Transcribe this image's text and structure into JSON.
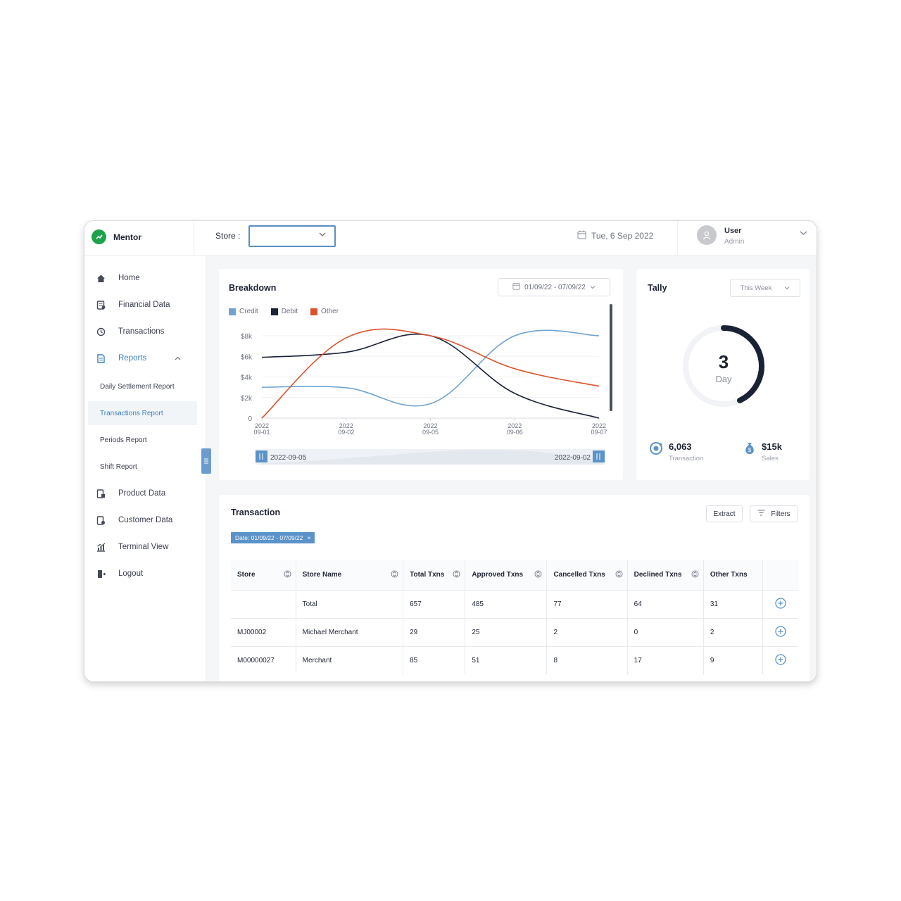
{
  "app": {
    "name": "Mentor"
  },
  "topbar": {
    "store_label": "Store :",
    "store_value": "",
    "date": "Tue, 6 Sep 2022",
    "user_name": "User",
    "user_role": "Admin"
  },
  "sidebar": {
    "items": [
      {
        "label": "Home",
        "icon": "home-icon"
      },
      {
        "label": "Financial Data",
        "icon": "financial-data-icon"
      },
      {
        "label": "Transactions",
        "icon": "transactions-icon"
      },
      {
        "label": "Reports",
        "icon": "reports-icon",
        "active": true
      }
    ],
    "sub_items": [
      {
        "label": "Daily Settlement Report"
      },
      {
        "label": "Transactions Report",
        "active": true
      },
      {
        "label": "Periods Report"
      },
      {
        "label": "Shift Report"
      }
    ],
    "more_items": [
      {
        "label": "Product Data",
        "icon": "product-data-icon"
      },
      {
        "label": "Customer Data",
        "icon": "customer-data-icon"
      },
      {
        "label": "Terminal View",
        "icon": "terminal-view-icon"
      },
      {
        "label": "Logout",
        "icon": "logout-icon"
      }
    ]
  },
  "breakdown": {
    "title": "Breakdown",
    "range": "01/09/22 - 07/09/22",
    "slider_start": "2022-09-05",
    "slider_end": "2022-09-02"
  },
  "chart_data": {
    "type": "line",
    "title": "Breakdown",
    "categories": [
      "2022-09-01",
      "2022-09-02",
      "2022-09-05",
      "2022-09-06",
      "2022-09-07"
    ],
    "tick_labels": [
      [
        "2022",
        "09-01"
      ],
      [
        "2022",
        "09-02"
      ],
      [
        "2022",
        "09-05"
      ],
      [
        "2022",
        "09-06"
      ],
      [
        "2022",
        "09-07"
      ]
    ],
    "y_ticks": [
      0,
      2000,
      4000,
      6000,
      8000
    ],
    "y_tick_labels": [
      "0",
      "$2k",
      "$4k",
      "$6k",
      "$8k"
    ],
    "ylim": [
      0,
      8000
    ],
    "grid": true,
    "legend": "top-left",
    "series": [
      {
        "name": "Credit",
        "color": "#6fa3cf",
        "values": [
          3000,
          2950,
          1400,
          8000,
          8000
        ]
      },
      {
        "name": "Debit",
        "color": "#1a2236",
        "values": [
          5900,
          6400,
          8000,
          2400,
          0
        ]
      },
      {
        "name": "Other",
        "color": "#d9542e",
        "values": [
          0,
          7800,
          8000,
          4800,
          3100
        ]
      }
    ]
  },
  "tally": {
    "title": "Tally",
    "period": "This Week",
    "gauge_value": "3",
    "gauge_unit": "Day",
    "gauge_fraction": 0.43,
    "transactions_value": "6,063",
    "transactions_label": "Transaction",
    "sales_value": "$15k",
    "sales_label": "Sales"
  },
  "transaction": {
    "title": "Transaction",
    "extract_label": "Extract",
    "filters_label": "Filters",
    "date_chip": "Date: 01/09/22 - 07/09/22",
    "columns": [
      "Store",
      "Store Name",
      "Total Txns",
      "Approved Txns",
      "Cancelled Txns",
      "Declined Txns",
      "Other Txns"
    ],
    "rows": [
      [
        "",
        "Total",
        "657",
        "485",
        "77",
        "64",
        "31"
      ],
      [
        "MJ00002",
        "Michael Merchant",
        "29",
        "25",
        "2",
        "0",
        "2"
      ],
      [
        "M00000027",
        "Merchant",
        "85",
        "51",
        "8",
        "17",
        "9"
      ]
    ]
  },
  "colors": {
    "accent": "#3e7fbf",
    "brand": "#1fa34a",
    "credit": "#6fa3cf",
    "debit": "#1a2236",
    "other": "#d9542e"
  }
}
